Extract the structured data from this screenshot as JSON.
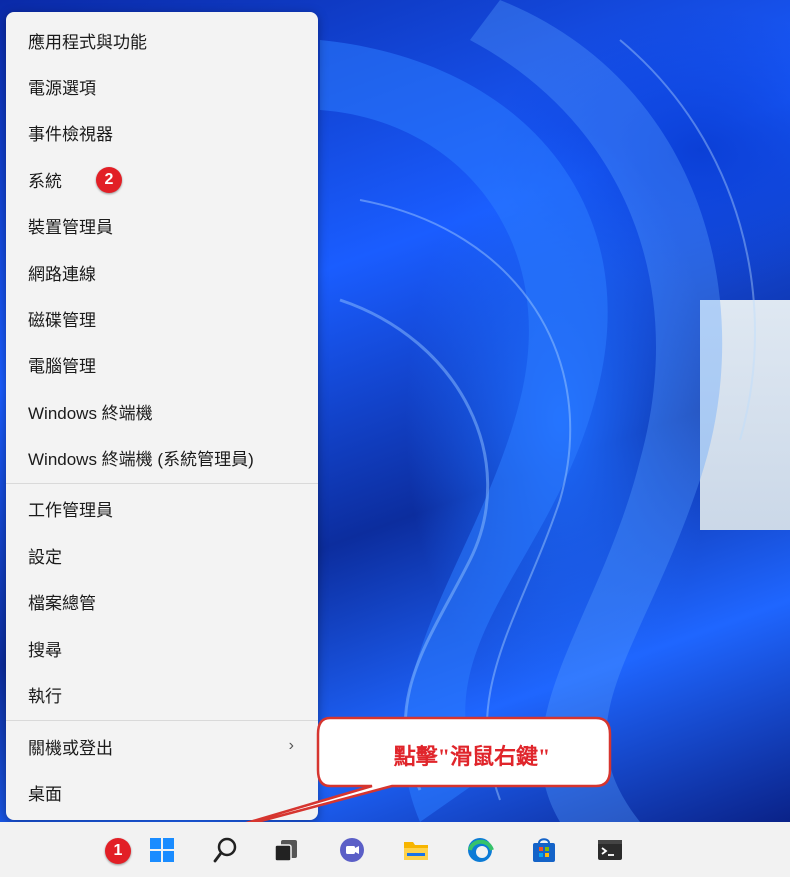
{
  "menu": {
    "items": [
      {
        "label": "應用程式與功能"
      },
      {
        "label": "電源選項"
      },
      {
        "label": "事件檢視器"
      },
      {
        "label": "系統"
      },
      {
        "label": "裝置管理員"
      },
      {
        "label": "網路連線"
      },
      {
        "label": "磁碟管理"
      },
      {
        "label": "電腦管理"
      },
      {
        "label": "Windows 終端機"
      },
      {
        "label": "Windows 終端機 (系統管理員)"
      },
      {
        "label": "工作管理員"
      },
      {
        "label": "設定"
      },
      {
        "label": "檔案總管"
      },
      {
        "label": "搜尋"
      },
      {
        "label": "執行"
      },
      {
        "label": "關機或登出"
      },
      {
        "label": "桌面"
      }
    ],
    "submenu_arrow": "›"
  },
  "annotations": {
    "step1": "1",
    "step2": "2",
    "callout": "點擊\"滑鼠右鍵\""
  },
  "taskbar": {
    "icons": [
      "windows-start-icon",
      "search-icon",
      "task-view-icon",
      "chat-icon",
      "file-explorer-icon",
      "edge-icon",
      "store-icon",
      "terminal-icon"
    ]
  },
  "colors": {
    "accent_red": "#e21f26",
    "wallpaper_blue": "#1a5dff"
  }
}
